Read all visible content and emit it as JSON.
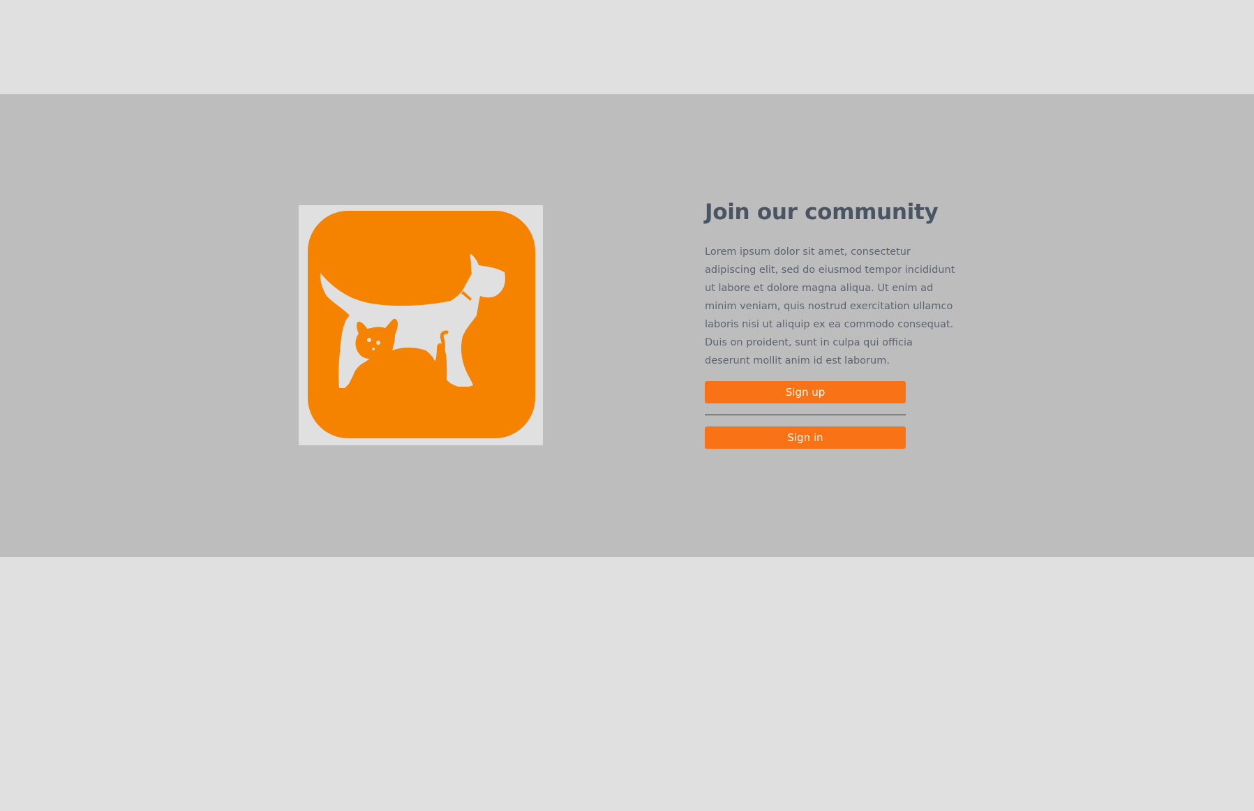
{
  "hero": {
    "logo": {
      "icon": "pet-dog-cat-logo-icon",
      "accent_color": "#f58300",
      "background_color": "#e0e0e0"
    },
    "title": "Join our community",
    "description": "Lorem ipsum dolor sit amet, consectetur adipiscing elit, sed do eiusmod tempor incididunt ut labore et dolore magna aliqua. Ut enim ad minim veniam, quis nostrud exercitation ullamco laboris nisi ut aliquip ex ea commodo consequat. Duis on proident, sunt in culpa qui officia deserunt mollit anim id est laborum.",
    "signup_label": "Sign up",
    "signin_label": "Sign in",
    "button_color": "#f97316"
  },
  "colors": {
    "page_background": "#e0e0e0",
    "hero_background": "#bdbdbd",
    "title_color": "#4a5563",
    "text_color": "#5b6470"
  }
}
